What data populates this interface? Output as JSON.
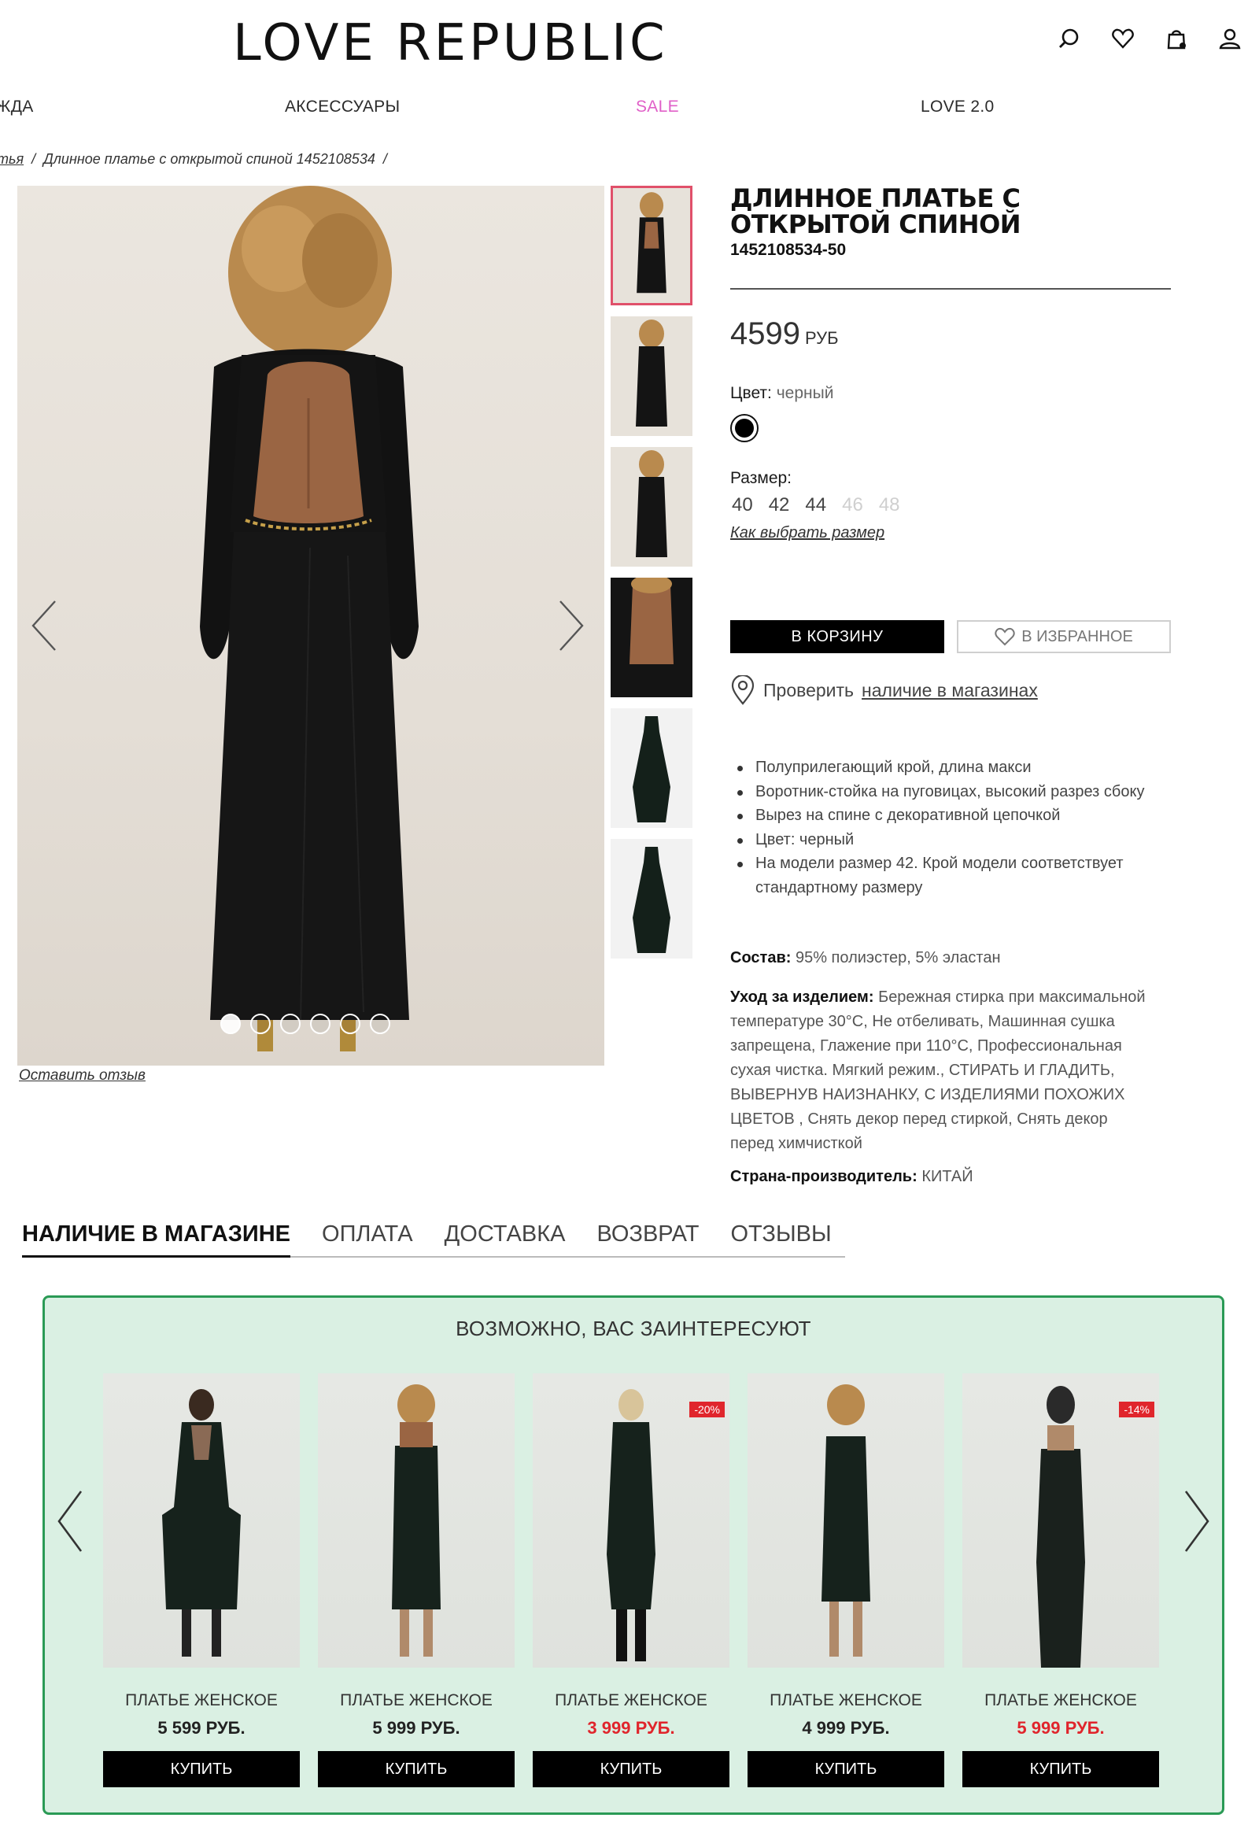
{
  "header": {
    "logo": "LOVE REPUBLIC",
    "icons": [
      "search-icon",
      "heart-icon",
      "bag-icon",
      "user-icon"
    ]
  },
  "nav": {
    "items": [
      {
        "label": "ЖДА"
      },
      {
        "label": "АКСЕССУАРЫ"
      },
      {
        "label": "SALE",
        "color": "#e060c8"
      },
      {
        "label": "LOVE 2.0"
      }
    ]
  },
  "breadcrumb": {
    "parent": "атья",
    "current": "Длинное платье с открытой спиной 1452108534"
  },
  "gallery": {
    "review_link": "Оставить отзыв",
    "thumbnail_count": 6,
    "dot_count": 6
  },
  "product": {
    "title": "Длинное платье с открытой спиной",
    "sku": "1452108534-50",
    "price": "4599",
    "currency": "РУБ",
    "color_label": "Цвет:",
    "color_value": "черный",
    "size_label": "Размер:",
    "sizes": [
      {
        "label": "40",
        "available": true
      },
      {
        "label": "42",
        "available": true
      },
      {
        "label": "44",
        "available": true
      },
      {
        "label": "46",
        "available": false
      },
      {
        "label": "48",
        "available": false
      }
    ],
    "size_guide": "Как выбрать размер",
    "add_to_cart": "В КОРЗИНУ",
    "add_to_favorites": "В ИЗБРАННОЕ",
    "stock_prefix": "Проверить",
    "stock_link": "наличие в магазинах",
    "features": [
      "Полуприлегающий крой, длина макси",
      "Воротник-стойка на пуговицах, высокий разрез сбоку",
      "Вырез на спине с декоративной цепочкой",
      "Цвет: черный",
      "На модели размер 42. Крой модели соответствует стандартному размеру"
    ],
    "composition_label": "Состав:",
    "composition": "95% полиэстер, 5% эластан",
    "care_label": "Уход за изделием:",
    "care": "Бережная стирка при максимальной температуре 30°С, Не отбеливать, Машинная сушка запрещена, Глажение при 110°С, Профессиональная сухая чистка. Мягкий режим., СТИРАТЬ И ГЛАДИТЬ, ВЫВЕРНУВ НАИЗНАНКУ, С ИЗДЕЛИЯМИ ПОХОЖИХ ЦВЕТОВ , Снять декор перед стиркой, Снять декор перед химчисткой",
    "country_label": "Страна-производитель:",
    "country": "КИТАЙ"
  },
  "tabs": [
    {
      "label": "НАЛИЧИЕ В МАГАЗИНЕ",
      "active": true
    },
    {
      "label": "ОПЛАТА"
    },
    {
      "label": "ДОСТАВКА"
    },
    {
      "label": "ВОЗВРАТ"
    },
    {
      "label": "ОТЗЫВЫ"
    }
  ],
  "recommendations": {
    "title": "ВОЗМОЖНО, ВАС ЗАИНТЕРЕСУЮТ",
    "items": [
      {
        "name": "ПЛАТЬЕ ЖЕНСКОЕ",
        "price": "5 599 РУБ.",
        "sale": false,
        "badge": "",
        "buy": "КУПИТЬ"
      },
      {
        "name": "ПЛАТЬЕ ЖЕНСКОЕ",
        "price": "5 999 РУБ.",
        "sale": false,
        "badge": "",
        "buy": "КУПИТЬ"
      },
      {
        "name": "ПЛАТЬЕ ЖЕНСКОЕ",
        "price": "3 999 РУБ.",
        "sale": true,
        "badge": "-20%",
        "buy": "КУПИТЬ"
      },
      {
        "name": "ПЛАТЬЕ ЖЕНСКОЕ",
        "price": "4 999 РУБ.",
        "sale": false,
        "badge": "",
        "buy": "КУПИТЬ"
      },
      {
        "name": "ПЛАТЬЕ ЖЕНСКОЕ",
        "price": "5 999 РУБ.",
        "sale": true,
        "badge": "-14%",
        "buy": "КУПИТЬ"
      }
    ]
  },
  "colors": {
    "sale_price": "#e0252c",
    "reco_background": "#daf0e3",
    "reco_border": "#2a9a55",
    "thumb_active_border": "#e0506a"
  }
}
